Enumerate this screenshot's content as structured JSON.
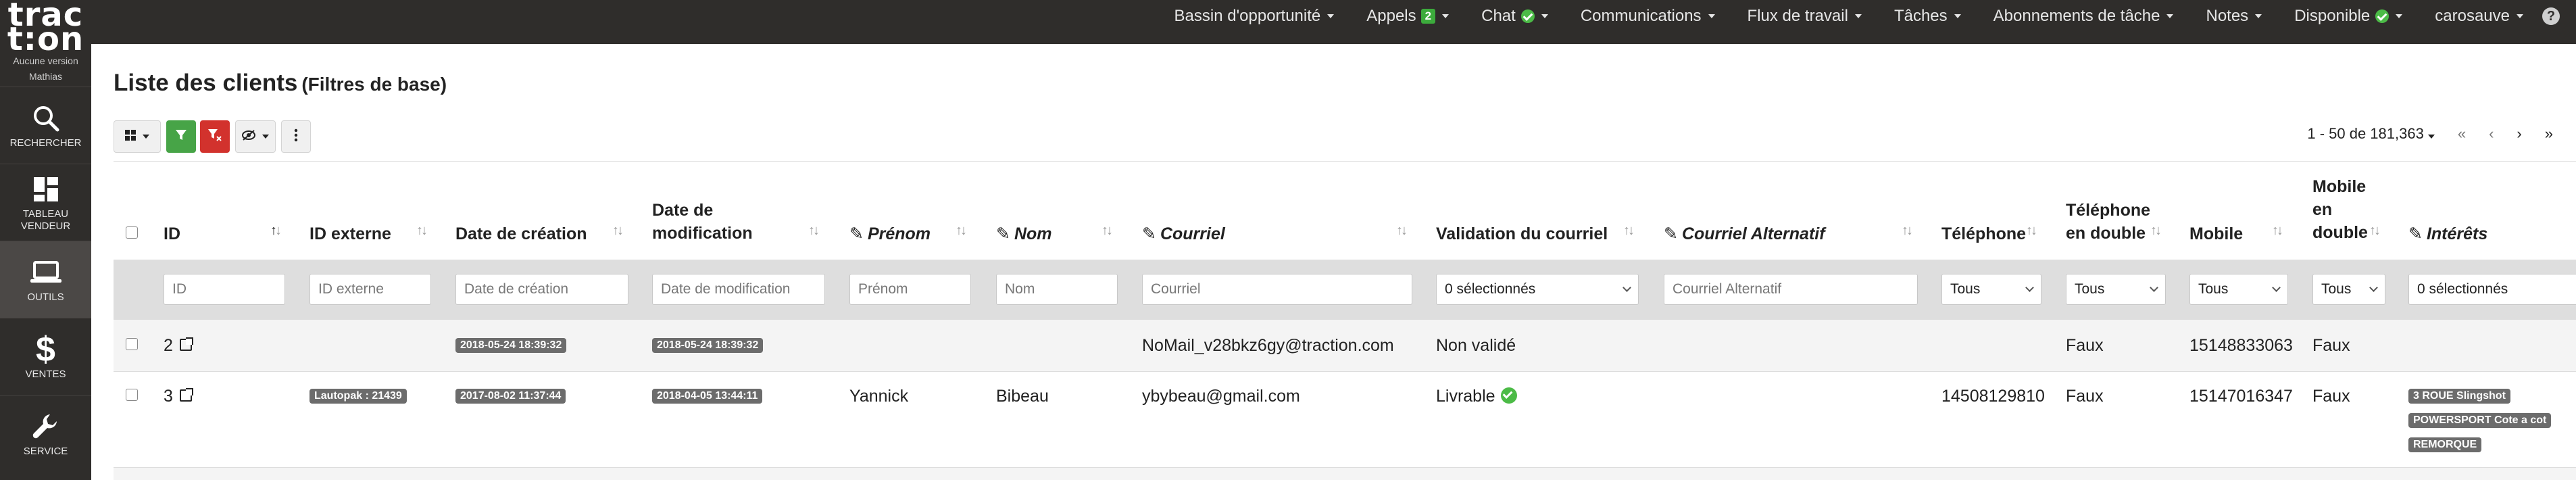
{
  "app": {
    "logo_line1": "trac",
    "logo_line2": "t:on",
    "version_label": "Aucune version",
    "user_label": "Mathias"
  },
  "topnav": {
    "items": [
      {
        "label": "Bassin d'opportunité"
      },
      {
        "label": "Appels",
        "badge": "2"
      },
      {
        "label": "Chat"
      },
      {
        "label": "Communications"
      },
      {
        "label": "Flux de travail"
      },
      {
        "label": "Tâches"
      },
      {
        "label": "Abonnements de tâche"
      },
      {
        "label": "Notes"
      },
      {
        "label": "Disponible"
      },
      {
        "label": "carosauve"
      }
    ],
    "help": "?"
  },
  "sidebar": {
    "items": [
      {
        "label": "RECHERCHER",
        "icon": "search-icon"
      },
      {
        "label": "TABLEAU VENDEUR",
        "icon": "dashboard-icon"
      },
      {
        "label": "OUTILS",
        "icon": "laptop-icon"
      },
      {
        "label": "VENTES",
        "icon": "dollar-icon"
      },
      {
        "label": "SERVICE",
        "icon": "wrench-icon"
      }
    ]
  },
  "page": {
    "title": "Liste des clients",
    "subtitle": "(Filtres de base)"
  },
  "pager": {
    "range": "1 - 50 de 181,363",
    "first": "«",
    "prev": "‹",
    "next": "›",
    "last": "»"
  },
  "columns": {
    "id": "ID",
    "external_id": "ID externe",
    "created": "Date de création",
    "modified_1": "Date de",
    "modified_2": "modification",
    "first_name": "Prénom",
    "last_name": "Nom",
    "email": "Courriel",
    "email_validation": "Validation du courriel",
    "alt_email": "Courriel Alternatif",
    "phone": "Téléphone",
    "phone_dup_1": "Téléphone",
    "phone_dup_2": "en double",
    "mobile": "Mobile",
    "mobile_dup_1": "Mobile",
    "mobile_dup_2": "en",
    "mobile_dup_3": "double",
    "interests": "Intérêts"
  },
  "filters": {
    "id": "ID",
    "external_id": "ID externe",
    "created": "Date de création",
    "modified": "Date de modification",
    "first_name": "Prénom",
    "last_name": "Nom",
    "email": "Courriel",
    "email_validation": "0 sélectionnés",
    "alt_email": "Courriel Alternatif",
    "phone": "Tous",
    "phone_dup": "Tous",
    "mobile": "Tous",
    "mobile_dup": "Tous",
    "interests": "0 sélectionnés"
  },
  "rows": [
    {
      "id": "2",
      "created": "2018-05-24 18:39:32",
      "modified": "2018-05-24 18:39:32",
      "email": "NoMail_v28bkz6gy@traction.com",
      "validation": "Non validé",
      "phone_dup": "Faux",
      "mobile": "15148833063",
      "mobile_dup": "Faux"
    },
    {
      "id": "3",
      "external_id": "Lautopak : 21439",
      "created": "2017-08-02 11:37:44",
      "modified": "2018-04-05 13:44:11",
      "first_name": "Yannick",
      "last_name": "Bibeau",
      "email": "ybybeau@gmail.com",
      "validation": "Livrable",
      "phone": "14508129810",
      "phone_dup": "Faux",
      "mobile": "15147016347",
      "mobile_dup": "Faux",
      "interests": [
        "3 ROUE Slingshot",
        "POWERSPORT Cote a cot",
        "REMORQUE"
      ]
    }
  ]
}
